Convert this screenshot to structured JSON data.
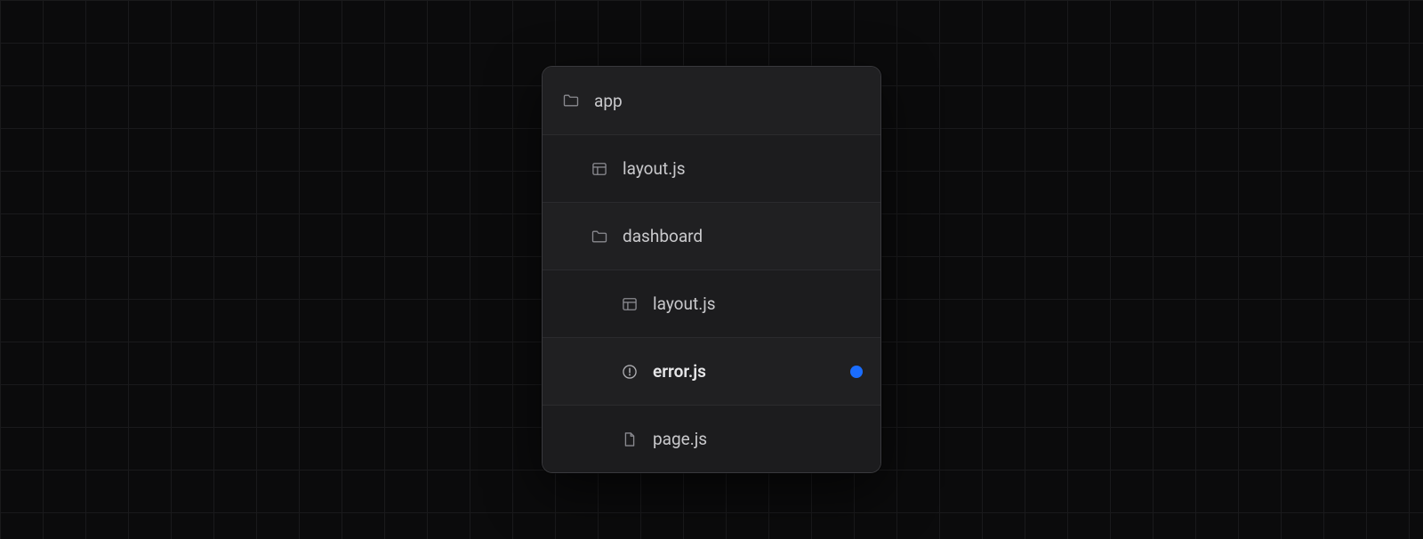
{
  "colors": {
    "dot": "#1a6dff",
    "background": "#0b0b0c",
    "panel": "#1c1c1e"
  },
  "tree": {
    "rows": [
      {
        "label": "app",
        "icon": "folder",
        "indent": 0,
        "highlighted": false,
        "hasDot": false
      },
      {
        "label": "layout.js",
        "icon": "layout",
        "indent": 1,
        "highlighted": false,
        "hasDot": false
      },
      {
        "label": "dashboard",
        "icon": "folder",
        "indent": 1,
        "highlighted": false,
        "hasDot": false
      },
      {
        "label": "layout.js",
        "icon": "layout",
        "indent": 2,
        "highlighted": false,
        "hasDot": false
      },
      {
        "label": "error.js",
        "icon": "error",
        "indent": 2,
        "highlighted": true,
        "hasDot": true
      },
      {
        "label": "page.js",
        "icon": "page",
        "indent": 2,
        "highlighted": false,
        "hasDot": false
      }
    ]
  }
}
